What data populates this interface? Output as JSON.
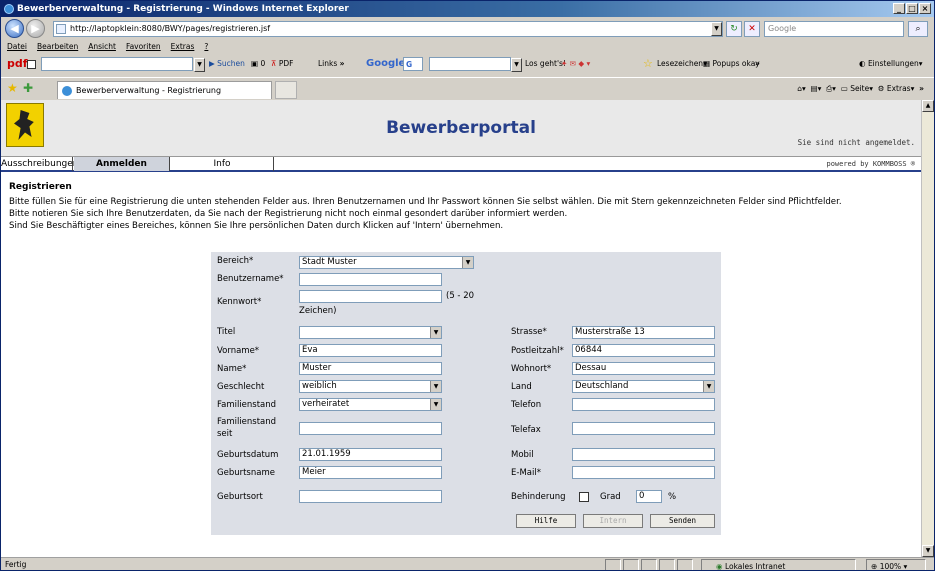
{
  "window": {
    "title": "Bewerberverwaltung - Registrierung - Windows Internet Explorer"
  },
  "address": {
    "url": "http://laptopklein:8080/BWY/pages/registrieren.jsf",
    "search_placeholder": "Google"
  },
  "menu": [
    "Datei",
    "Bearbeiten",
    "Ansicht",
    "Favoriten",
    "Extras",
    "?"
  ],
  "toolbar": {
    "pdf": "pdf",
    "suchen": "Suchen",
    "count": "0",
    "pdf2": "PDF",
    "links": "Links",
    "links_more": "»",
    "google": "Google",
    "g_label": "G",
    "losgehts": "Los geht's!",
    "lesezeichen": "Lesezeichen",
    "popups": "Popups okay",
    "more": "»",
    "einstellungen": "Einstellungen"
  },
  "tab": {
    "label": "Bewerberverwaltung - Registrierung"
  },
  "commandbar": {
    "seite": "Seite",
    "extras": "Extras",
    "more": "»"
  },
  "header": {
    "title": "Bewerberportal",
    "status": "Sie sind nicht angemeldet."
  },
  "nav": {
    "tabs": [
      "Ausschreibungen",
      "Anmelden",
      "Info"
    ],
    "powered": "powered by KOMMBOSS ®"
  },
  "intro": {
    "heading": "Registrieren",
    "lines": [
      "Bitte füllen Sie für eine Registrierung die unten stehenden Felder aus. Ihren Benutzernamen und Ihr Passwort können Sie selbst wählen. Die mit Stern gekennzeichneten Felder sind Pflichtfelder.",
      "Bitte notieren Sie sich Ihre Benutzerdaten, da Sie nach der Registrierung nicht noch einmal gesondert darüber informiert werden.",
      "Sind Sie Beschäftigter eines Bereiches, können Sie Ihre persönlichen Daten durch Klicken auf 'Intern' übernehmen."
    ]
  },
  "form": {
    "bereich": {
      "label": "Bereich*",
      "value": "Stadt Muster"
    },
    "benutzername": {
      "label": "Benutzername*",
      "value": ""
    },
    "kennwort": {
      "label": "Kennwort*",
      "value": "",
      "hint1": "(5 - 20",
      "hint2": "Zeichen)"
    },
    "left": [
      {
        "key": "titel",
        "label": "Titel",
        "value": "",
        "type": "select"
      },
      {
        "key": "vorname",
        "label": "Vorname*",
        "value": "Eva",
        "type": "input"
      },
      {
        "key": "name",
        "label": "Name*",
        "value": "Muster",
        "type": "input"
      },
      {
        "key": "geschlecht",
        "label": "Geschlecht",
        "value": "weiblich",
        "type": "select"
      },
      {
        "key": "familienstand",
        "label": "Familienstand",
        "value": "verheiratet",
        "type": "select"
      },
      {
        "key": "familienstand_seit",
        "label": "Familienstand seit",
        "label1": "Familienstand",
        "label2": "seit",
        "value": "",
        "type": "input"
      },
      {
        "key": "geburtsdatum",
        "label": "Geburtsdatum",
        "value": "21.01.1959",
        "type": "input"
      },
      {
        "key": "geburtsname",
        "label": "Geburtsname",
        "value": "Meier",
        "type": "input"
      },
      {
        "key": "geburtsort",
        "label": "Geburtsort",
        "value": "",
        "type": "input"
      }
    ],
    "right": [
      {
        "key": "strasse",
        "label": "Strasse*",
        "value": "Musterstraße 13",
        "type": "input"
      },
      {
        "key": "plz",
        "label": "Postleitzahl*",
        "value": "06844",
        "type": "input"
      },
      {
        "key": "wohnort",
        "label": "Wohnort*",
        "value": "Dessau",
        "type": "input"
      },
      {
        "key": "land",
        "label": "Land",
        "value": "Deutschland",
        "type": "select"
      },
      {
        "key": "telefon",
        "label": "Telefon",
        "value": "",
        "type": "input"
      },
      {
        "key": "telefax",
        "label": "Telefax",
        "value": "",
        "type": "input"
      },
      {
        "key": "mobil",
        "label": "Mobil",
        "value": "",
        "type": "input"
      },
      {
        "key": "email",
        "label": "E-Mail*",
        "value": "",
        "type": "input"
      }
    ],
    "behinderung": {
      "label": "Behinderung",
      "grad_label": "Grad",
      "grad_value": "0",
      "unit": "%"
    },
    "buttons": {
      "hilfe": "Hilfe",
      "intern": "Intern",
      "senden": "Senden"
    }
  },
  "status": {
    "left": "Fertig",
    "zone": "Lokales Intranet",
    "zoom": "100%"
  }
}
